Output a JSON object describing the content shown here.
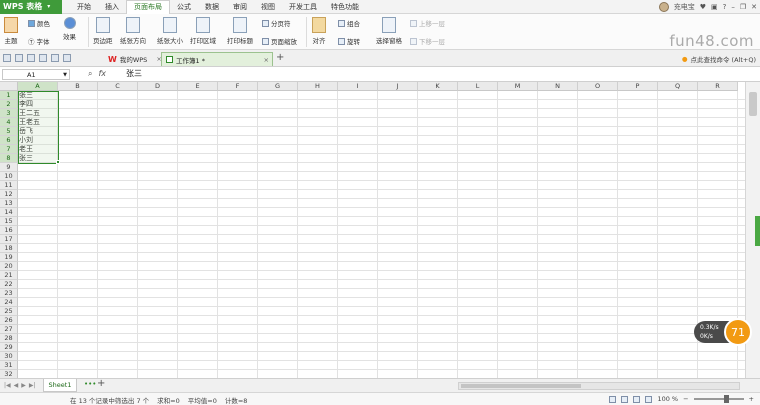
{
  "app": {
    "title": "WPS 表格",
    "user": "充电宝"
  },
  "menu": {
    "tabs": [
      "开始",
      "插入",
      "页面布局",
      "公式",
      "数据",
      "审阅",
      "视图",
      "开发工具",
      "特色功能"
    ],
    "active": "页面布局"
  },
  "ribbon": {
    "theme": "主题",
    "colors": "颜色",
    "fonts": "字体",
    "effects": "效果",
    "margins": "页边距",
    "orientation": "纸张方向",
    "size": "纸张大小",
    "print_area": "打印区域",
    "print_titles": "打印标题",
    "page_break": "分页符",
    "page_zoom": "页面缩放",
    "align": "对齐",
    "group": "组合",
    "rotate": "旋转",
    "selection_pane": "选择窗格",
    "bring_forward": "上移一层",
    "send_backward": "下移一层"
  },
  "watermark": "fun48.com",
  "doc_tabs": {
    "my_wps": "我的WPS",
    "workbook": "工作簿1 *"
  },
  "search_cmd": "点此查找命令 (Alt+Q)",
  "formula_bar": {
    "cell_ref": "A1",
    "value": "张三"
  },
  "columns": [
    "A",
    "B",
    "C",
    "D",
    "E",
    "F",
    "G",
    "H",
    "I",
    "J",
    "K",
    "L",
    "M",
    "N",
    "O",
    "P",
    "Q",
    "R"
  ],
  "rows": 32,
  "cells_A": [
    "张三",
    "李四",
    "王二五",
    "王老五",
    "岳飞",
    "小刘",
    "老王",
    "张三"
  ],
  "sheet": {
    "name": "Sheet1"
  },
  "status": {
    "filter": "在 13 个记录中筛选出 7 个",
    "sum": "求和=0",
    "avg": "平均值=0",
    "count": "计数=8",
    "zoom": "100 %"
  },
  "net_speed": {
    "up": "0.3K/s",
    "down": "0K/s",
    "value": "71"
  },
  "colors": {
    "brand": "#3f9b3a",
    "selection": "#2f8a2a",
    "badge": "#f29a12"
  }
}
